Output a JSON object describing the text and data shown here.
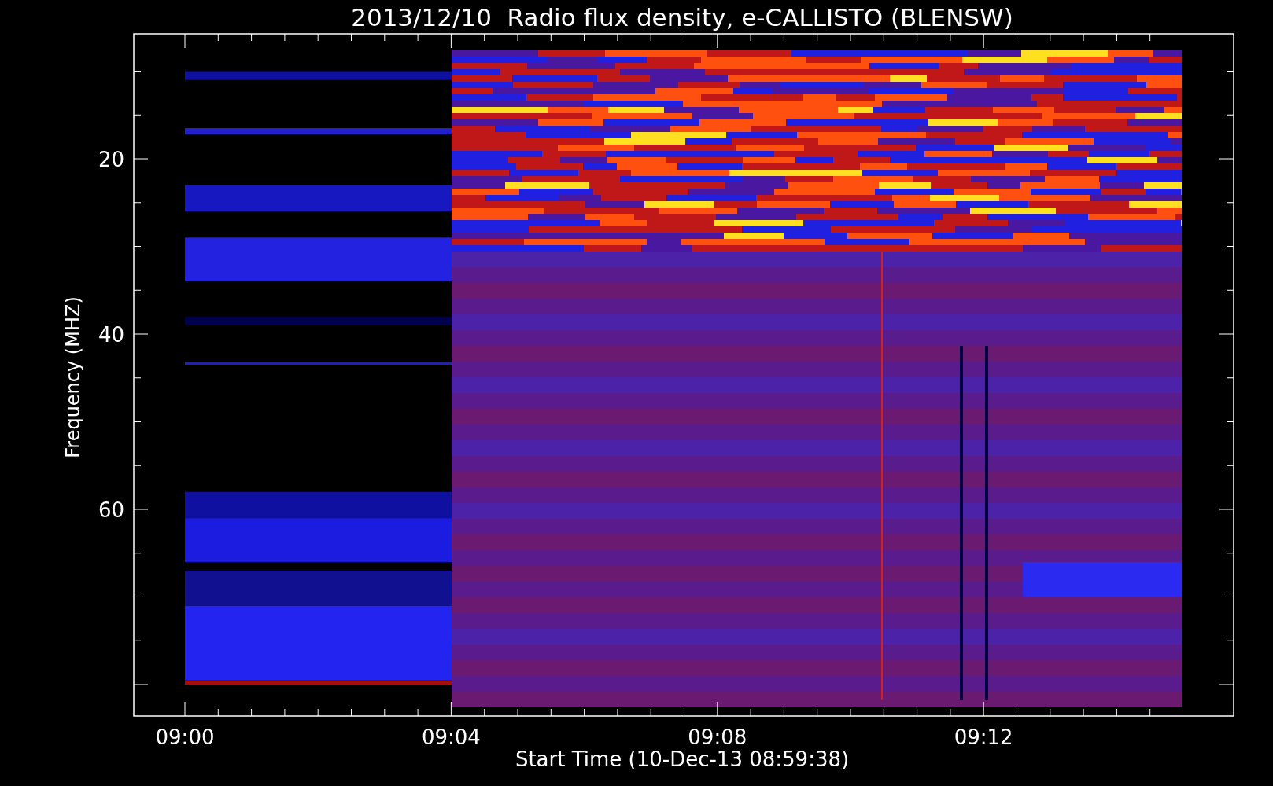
{
  "title": "2013/12/10  Radio flux density, e-CALLISTO (BLENSW)",
  "y_axis": {
    "label": "Frequency (MHZ)",
    "ticks": [
      "20",
      "40",
      "60"
    ]
  },
  "x_axis": {
    "label": "Start Time (10-Dec-13 08:59:38)",
    "ticks": [
      "09:00",
      "09:04",
      "09:08",
      "09:12"
    ]
  }
}
